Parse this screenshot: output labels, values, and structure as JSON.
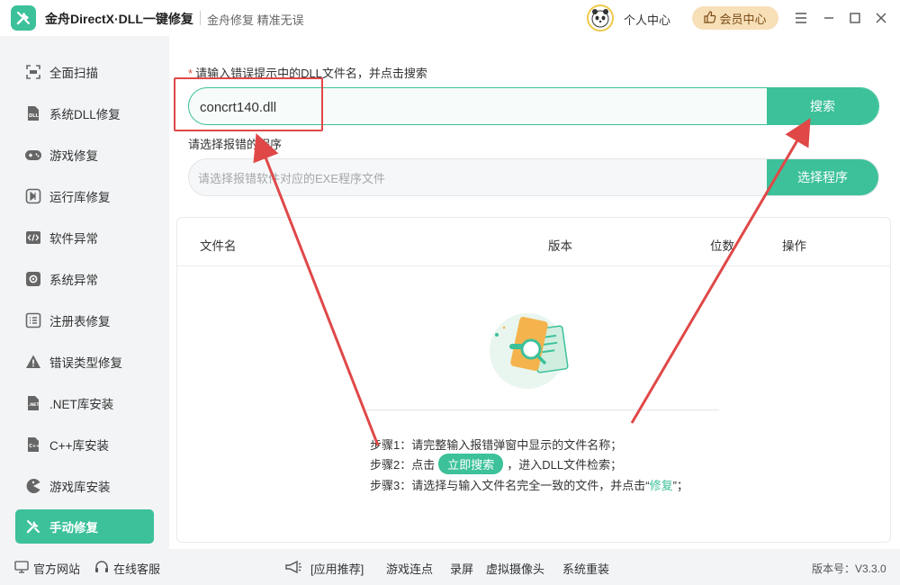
{
  "titlebar": {
    "title": "金舟DirectX·DLL一键修复",
    "slogan": "金舟修复 精准无误",
    "personal": "个人中心",
    "vip": "会员中心"
  },
  "sidebar": {
    "items": [
      {
        "label": "全面扫描",
        "icon": "scan-icon"
      },
      {
        "label": "系统DLL修复",
        "icon": "dll-icon"
      },
      {
        "label": "游戏修复",
        "icon": "gamepad-icon"
      },
      {
        "label": "运行库修复",
        "icon": "runtime-icon"
      },
      {
        "label": "软件异常",
        "icon": "code-icon"
      },
      {
        "label": "系统异常",
        "icon": "gear-icon"
      },
      {
        "label": "注册表修复",
        "icon": "list-icon"
      },
      {
        "label": "错误类型修复",
        "icon": "warning-icon"
      },
      {
        "label": ".NET库安装",
        "icon": "dotnet-icon"
      },
      {
        "label": "C++库安装",
        "icon": "cpp-icon"
      },
      {
        "label": "游戏库安装",
        "icon": "pacman-icon"
      },
      {
        "label": "手动修复",
        "icon": "tools-icon"
      }
    ],
    "active_index": 11
  },
  "main": {
    "required_mark": "*",
    "dll_label": "请输入错误提示中的DLL文件名，并点击搜索",
    "dll_value": "concrt140.dll",
    "search_button": "搜索",
    "program_label": "请选择报错的程序",
    "program_placeholder": "请选择报错软件对应的EXE程序文件",
    "program_button": "选择程序",
    "table": {
      "columns": [
        "文件名",
        "版本",
        "位数",
        "操作"
      ]
    },
    "steps": {
      "step1": "步骤1：请完整输入报错弹窗中显示的文件名称；",
      "step2_pre": "步骤2：点击",
      "step2_pill": "立即搜索",
      "step2_post": "，进入DLL文件检索；",
      "step3_pre": "步骤3：请选择与输入文件名完全一致的文件，并点击“",
      "step3_kw": "修复",
      "step3_post": "”；"
    }
  },
  "footer": {
    "website": "官方网站",
    "support": "在线客服",
    "recommend": "[应用推荐]",
    "links": [
      "游戏连点",
      "录屏",
      "虚拟摄像头",
      "系统重装"
    ],
    "version": "版本号：V3.3.0"
  },
  "colors": {
    "accent": "#3cc19a",
    "annotation": "#e04848",
    "vip_bg": "#f7dfb8"
  }
}
